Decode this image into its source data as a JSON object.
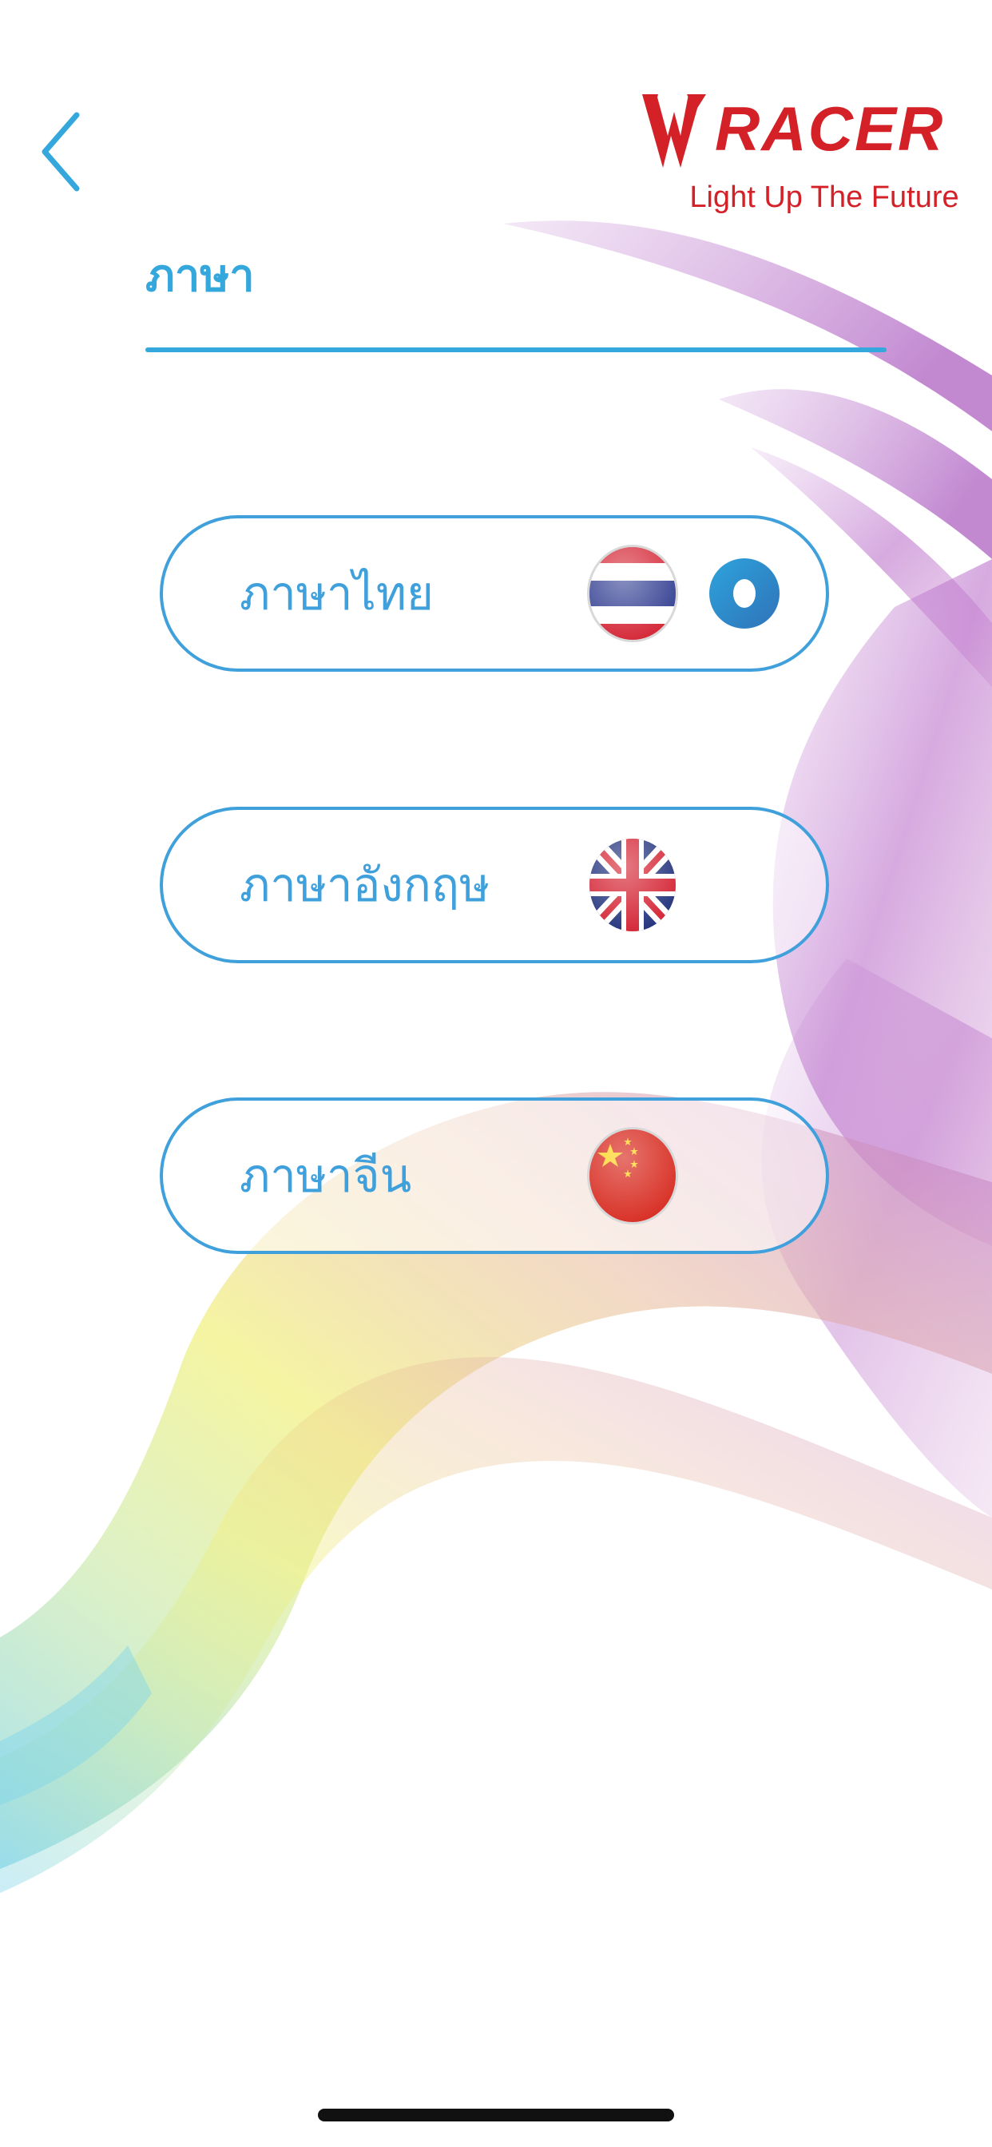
{
  "header": {
    "back_icon": "chevron-left-icon",
    "brand_name": "RACER",
    "brand_tagline": "Light Up The Future"
  },
  "page": {
    "title": "ภาษา"
  },
  "languages": [
    {
      "label": "ภาษาไทย",
      "flag_icon": "thailand-flag-icon",
      "selected": true
    },
    {
      "label": "ภาษาอังกฤษ",
      "flag_icon": "united-kingdom-flag-icon",
      "selected": false
    },
    {
      "label": "ภาษาจีน",
      "flag_icon": "china-flag-icon",
      "selected": false
    }
  ],
  "colors": {
    "accent": "#34a7dc",
    "brand": "#d42128"
  }
}
